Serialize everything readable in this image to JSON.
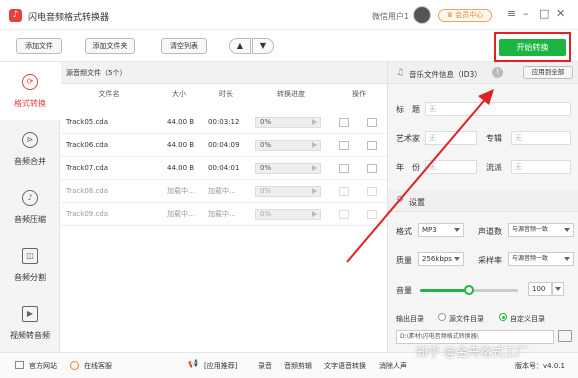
{
  "app": {
    "title": "闪电音频格式转换器",
    "user": "微信用户1",
    "vip": "会员中心"
  },
  "window_controls": {
    "menu": "≡",
    "minimize": "–",
    "maximize": "□",
    "close": "✕"
  },
  "toolbar": {
    "add_file": "添加文件",
    "add_folder": "添加文件夹",
    "clear_list": "清空列表",
    "up": "▲",
    "down": "▼",
    "start": "开始转换"
  },
  "sidebar": {
    "items": [
      {
        "label": "格式转换",
        "icon": "refresh-icon",
        "glyph": "⟳"
      },
      {
        "label": "音频合并",
        "icon": "merge-icon",
        "glyph": "⊳"
      },
      {
        "label": "音频压缩",
        "icon": "compress-icon",
        "glyph": "♪"
      },
      {
        "label": "音频分割",
        "icon": "split-icon",
        "glyph": "◫"
      },
      {
        "label": "视频转音频",
        "icon": "video-icon",
        "glyph": "▶"
      }
    ]
  },
  "file_panel": {
    "header": "源音频文件（5个）",
    "columns": [
      "文件名",
      "大小",
      "时长",
      "转换进度",
      "操作"
    ],
    "rows": [
      {
        "name": "Track05.cda",
        "size": "44.00 B",
        "duration": "00:03:12",
        "progress": "0%"
      },
      {
        "name": "Track06.cda",
        "size": "44.00 B",
        "duration": "00:04:09",
        "progress": "0%"
      },
      {
        "name": "Track07.cda",
        "size": "44.00 B",
        "duration": "00:04:01",
        "progress": "0%"
      },
      {
        "name": "Track08.cda",
        "size": "加载中...",
        "duration": "加载中...",
        "progress": "0%"
      },
      {
        "name": "Track09.cda",
        "size": "加载中...",
        "duration": "加载中...",
        "progress": "0%"
      }
    ]
  },
  "id3": {
    "title": "音乐文件信息（ID3）",
    "apply_all": "应用到全部",
    "fields": {
      "title_label": "标　题",
      "artist_label": "艺术家",
      "album_label": "专辑",
      "year_label": "年　份",
      "genre_label": "流派",
      "empty": "无"
    }
  },
  "settings": {
    "title": "设置",
    "format_label": "格式",
    "format_value": "MP3",
    "channel_label": "声道数",
    "channel_value": "与源音频一致",
    "quality_label": "质量",
    "quality_value": "256kbps",
    "sample_label": "采样率",
    "sample_value": "与源音频一致",
    "volume_label": "音量",
    "volume_value": "100",
    "volume_fraction": 0.5,
    "output_label": "输出目录",
    "opt_source": "源文件目录",
    "opt_custom": "自定义目录",
    "output_path": "D:\\素材\\闪电音频格式转换器\\"
  },
  "status": {
    "website": "官方网站",
    "support": "在线客服",
    "recommend": "[应用推荐]",
    "rec1": "录音",
    "rec2": "音频剪辑",
    "rec3": "文字语音转换",
    "rec4": "消除人声",
    "version": "版本号：v4.0.1"
  },
  "watermark": "知乎 @金舟格式工厂",
  "colors": {
    "accent": "#e8403a",
    "start": "#1db542",
    "annotation": "#e02222"
  }
}
